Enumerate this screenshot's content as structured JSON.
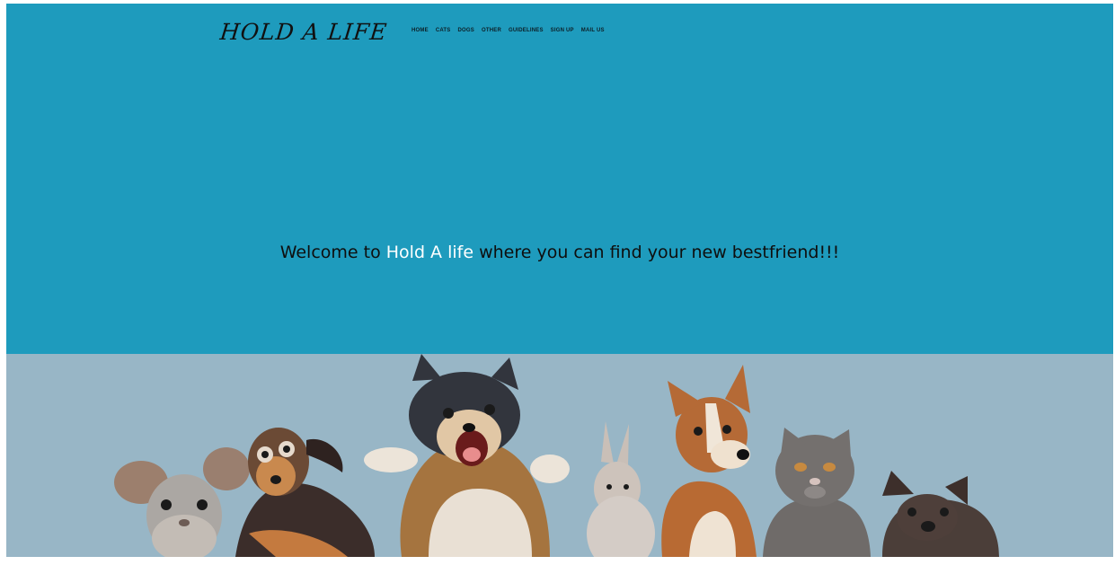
{
  "header": {
    "logo": "HOLD A LIFE",
    "nav": [
      {
        "label": "HOME"
      },
      {
        "label": "CATS"
      },
      {
        "label": "DOGS"
      },
      {
        "label": "OTHER"
      },
      {
        "label": "GUIDELINES"
      },
      {
        "label": "SIGN UP"
      },
      {
        "label": "MAIL US"
      }
    ]
  },
  "hero": {
    "welcome_prefix": "Welcome to ",
    "welcome_brand": "Hold A life",
    "welcome_suffix": " where you can find your new bestfriend!!!"
  },
  "colors": {
    "hero_bg": "#1e9bbd",
    "animals_bg": "#98b6c6",
    "brand_text": "#ffffff"
  },
  "banner": {
    "animals": [
      "chinchilla",
      "dachshund",
      "husky",
      "rabbit",
      "basenji",
      "cat",
      "french-bulldog"
    ]
  }
}
